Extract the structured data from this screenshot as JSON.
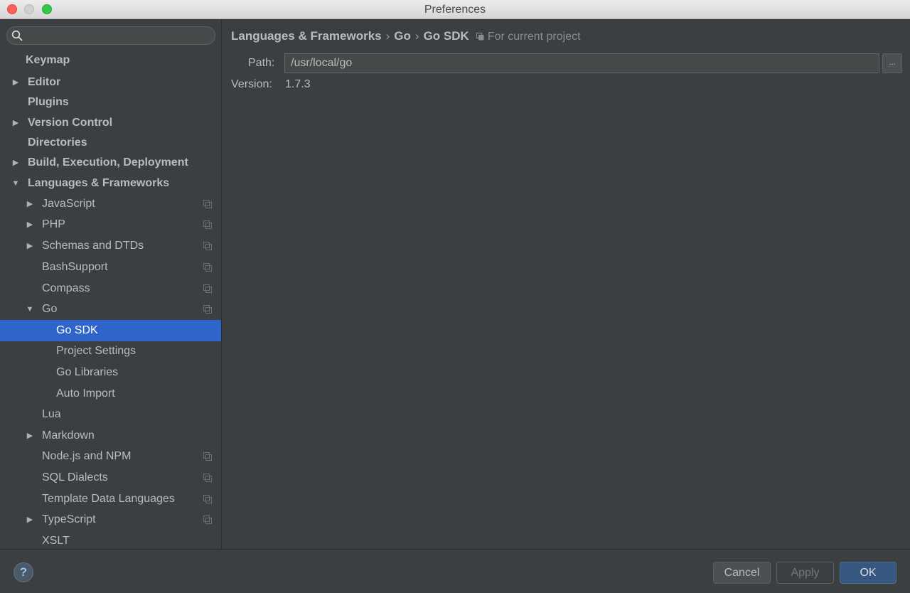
{
  "window": {
    "title": "Preferences"
  },
  "search": {
    "placeholder": "",
    "value": ""
  },
  "sidebar": {
    "items": [
      {
        "label": "Keymap",
        "level": 0,
        "arrow": "",
        "bold": true,
        "project_icon": false,
        "selected": false
      },
      {
        "label": "Editor",
        "level": 0,
        "arrow": "right",
        "bold": true,
        "project_icon": false,
        "selected": false
      },
      {
        "label": "Plugins",
        "level": 0,
        "arrow": "",
        "bold": true,
        "project_icon": false,
        "selected": false
      },
      {
        "label": "Version Control",
        "level": 0,
        "arrow": "right",
        "bold": true,
        "project_icon": false,
        "selected": false
      },
      {
        "label": "Directories",
        "level": 0,
        "arrow": "",
        "bold": true,
        "project_icon": false,
        "selected": false
      },
      {
        "label": "Build, Execution, Deployment",
        "level": 0,
        "arrow": "right",
        "bold": true,
        "project_icon": false,
        "selected": false
      },
      {
        "label": "Languages & Frameworks",
        "level": 0,
        "arrow": "down",
        "bold": true,
        "project_icon": false,
        "selected": false
      },
      {
        "label": "JavaScript",
        "level": 1,
        "arrow": "right",
        "bold": false,
        "project_icon": true,
        "selected": false
      },
      {
        "label": "PHP",
        "level": 1,
        "arrow": "right",
        "bold": false,
        "project_icon": true,
        "selected": false
      },
      {
        "label": "Schemas and DTDs",
        "level": 1,
        "arrow": "right",
        "bold": false,
        "project_icon": true,
        "selected": false
      },
      {
        "label": "BashSupport",
        "level": 1,
        "arrow": "",
        "bold": false,
        "project_icon": true,
        "selected": false
      },
      {
        "label": "Compass",
        "level": 1,
        "arrow": "",
        "bold": false,
        "project_icon": true,
        "selected": false
      },
      {
        "label": "Go",
        "level": 1,
        "arrow": "down",
        "bold": false,
        "project_icon": true,
        "selected": false
      },
      {
        "label": "Go SDK",
        "level": 2,
        "arrow": "",
        "bold": false,
        "project_icon": false,
        "selected": true
      },
      {
        "label": "Project Settings",
        "level": 2,
        "arrow": "",
        "bold": false,
        "project_icon": false,
        "selected": false
      },
      {
        "label": "Go Libraries",
        "level": 2,
        "arrow": "",
        "bold": false,
        "project_icon": false,
        "selected": false
      },
      {
        "label": "Auto Import",
        "level": 2,
        "arrow": "",
        "bold": false,
        "project_icon": false,
        "selected": false
      },
      {
        "label": "Lua",
        "level": 1,
        "arrow": "",
        "bold": false,
        "project_icon": false,
        "selected": false
      },
      {
        "label": "Markdown",
        "level": 1,
        "arrow": "right",
        "bold": false,
        "project_icon": false,
        "selected": false
      },
      {
        "label": "Node.js and NPM",
        "level": 1,
        "arrow": "",
        "bold": false,
        "project_icon": true,
        "selected": false
      },
      {
        "label": "SQL Dialects",
        "level": 1,
        "arrow": "",
        "bold": false,
        "project_icon": true,
        "selected": false
      },
      {
        "label": "Template Data Languages",
        "level": 1,
        "arrow": "",
        "bold": false,
        "project_icon": true,
        "selected": false
      },
      {
        "label": "TypeScript",
        "level": 1,
        "arrow": "right",
        "bold": false,
        "project_icon": true,
        "selected": false
      },
      {
        "label": "XSLT",
        "level": 1,
        "arrow": "",
        "bold": false,
        "project_icon": false,
        "selected": false
      }
    ]
  },
  "breadcrumb": {
    "parts": [
      "Languages & Frameworks",
      "Go",
      "Go SDK"
    ],
    "separator": "›",
    "scope": "For current project"
  },
  "sdk": {
    "path_label": "Path:",
    "path_value": "/usr/local/go",
    "browse_label": "...",
    "version_label": "Version:",
    "version_value": "1.7.3"
  },
  "footer": {
    "help_label": "?",
    "cancel_label": "Cancel",
    "apply_label": "Apply",
    "ok_label": "OK"
  },
  "colors": {
    "background": "#3c3f41",
    "selection": "#2f65ca",
    "ok_button": "#365880",
    "text": "#bbbbbb"
  }
}
